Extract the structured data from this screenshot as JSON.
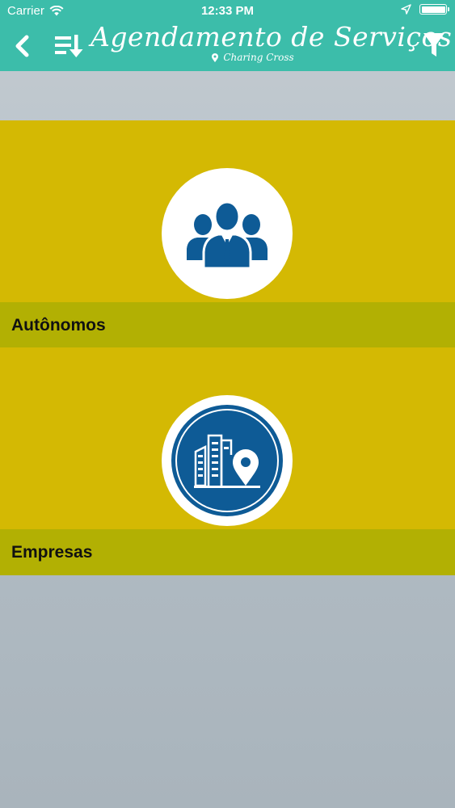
{
  "status_bar": {
    "carrier": "Carrier",
    "time": "12:33 PM"
  },
  "nav": {
    "title": "Agendamento de Serviços",
    "location": "Charing Cross",
    "icons": [
      "back-icon",
      "sort-icon",
      "filter-icon"
    ]
  },
  "categories": [
    {
      "label": "Autônomos",
      "icon": "people-group-icon"
    },
    {
      "label": "Empresas",
      "icon": "building-location-icon"
    }
  ],
  "colors": {
    "header": "#3cbdaa",
    "category_bg": "#d4b903",
    "label_bar": "#b2b003",
    "icon_blue": "#0e5b96"
  }
}
